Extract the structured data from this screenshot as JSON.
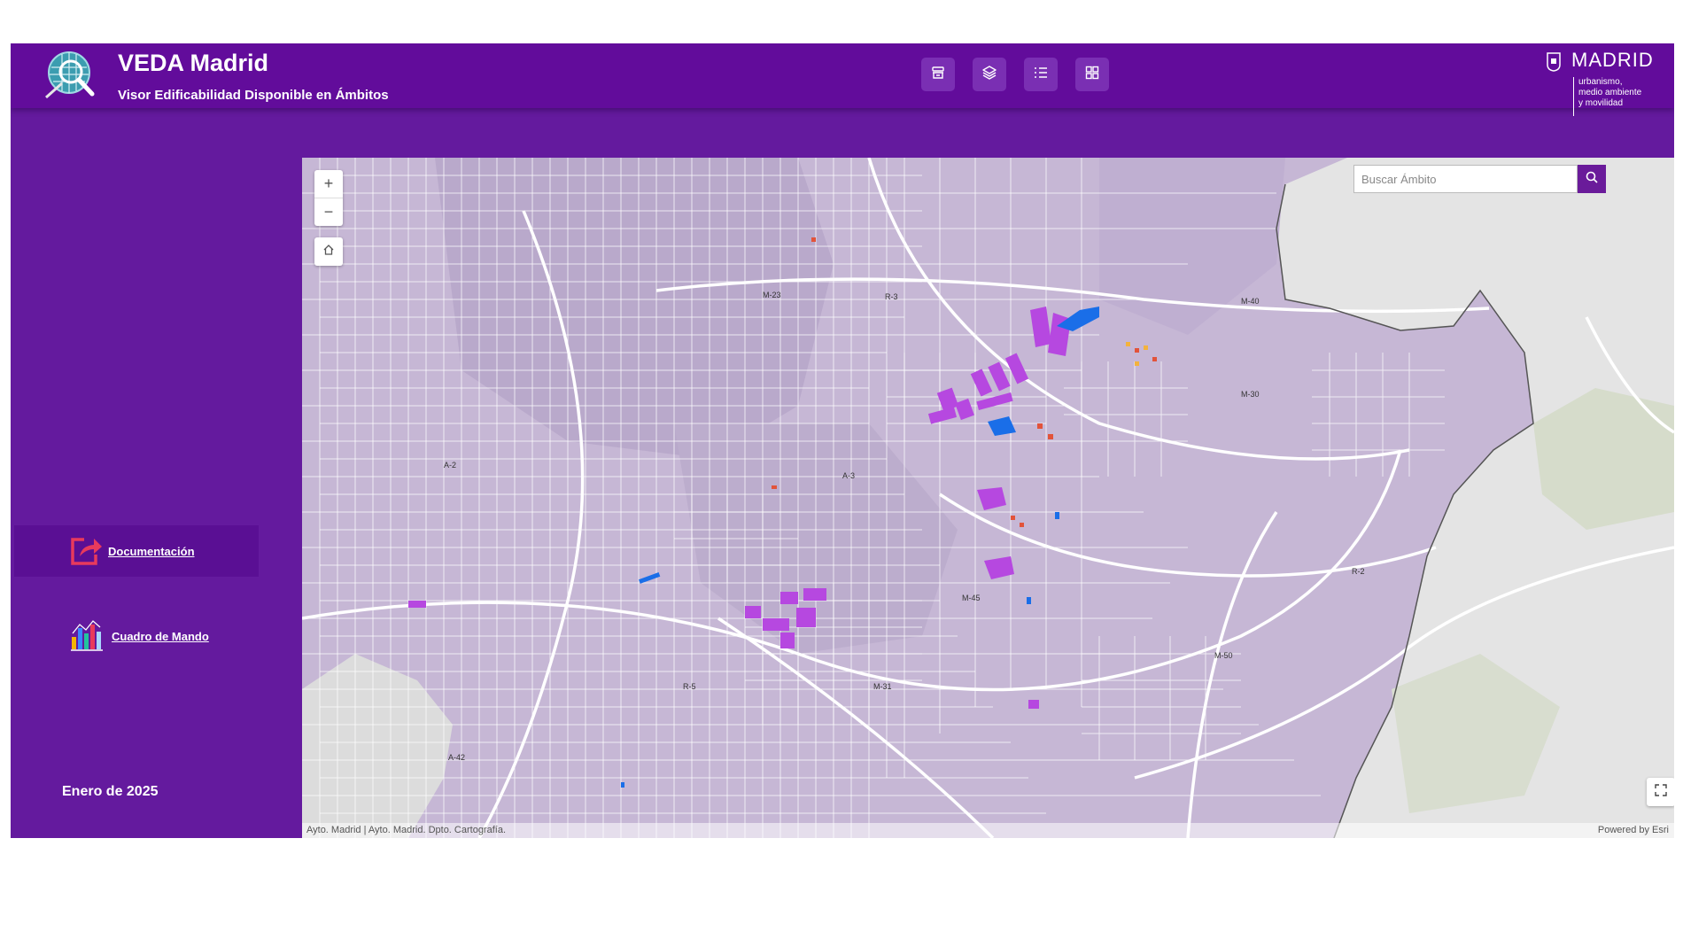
{
  "header": {
    "title": "VEDA Madrid",
    "subtitle": "Visor Edificabilidad Disponible en Ámbitos",
    "tools": [
      {
        "icon": "basemap-icon"
      },
      {
        "icon": "layers-icon"
      },
      {
        "icon": "legend-icon"
      },
      {
        "icon": "grid-icon"
      }
    ],
    "brand": {
      "name": "MADRID",
      "lines": [
        "urbanismo,",
        "medio ambiente",
        "y movilidad"
      ]
    }
  },
  "sidebar": {
    "items": [
      {
        "label": "Documentación",
        "icon": "share-icon"
      },
      {
        "label": "Cuadro de Mando",
        "icon": "bar-chart-icon"
      }
    ],
    "date": "Enero de 2025"
  },
  "map": {
    "search": {
      "placeholder": "Buscar Ámbito"
    },
    "zoom_in": "+",
    "zoom_out": "−",
    "attribution": "Ayto. Madrid | Ayto. Madrid. Dpto. Cartografía.",
    "powered_by": "Powered by Esri",
    "road_labels": [
      "M-23",
      "R-3",
      "M-40",
      "M-30",
      "A-3",
      "M-45",
      "M-50",
      "R-2",
      "A-2",
      "A-42",
      "M-31",
      "R-5"
    ]
  },
  "colors": {
    "header": "#620c9b",
    "sidebar": "#641a9e",
    "map_fill": "#c6b7d5",
    "parcel_magenta": "#b648e0",
    "parcel_blue": "#1a6ee8",
    "search_button": "#6a1b9a"
  }
}
